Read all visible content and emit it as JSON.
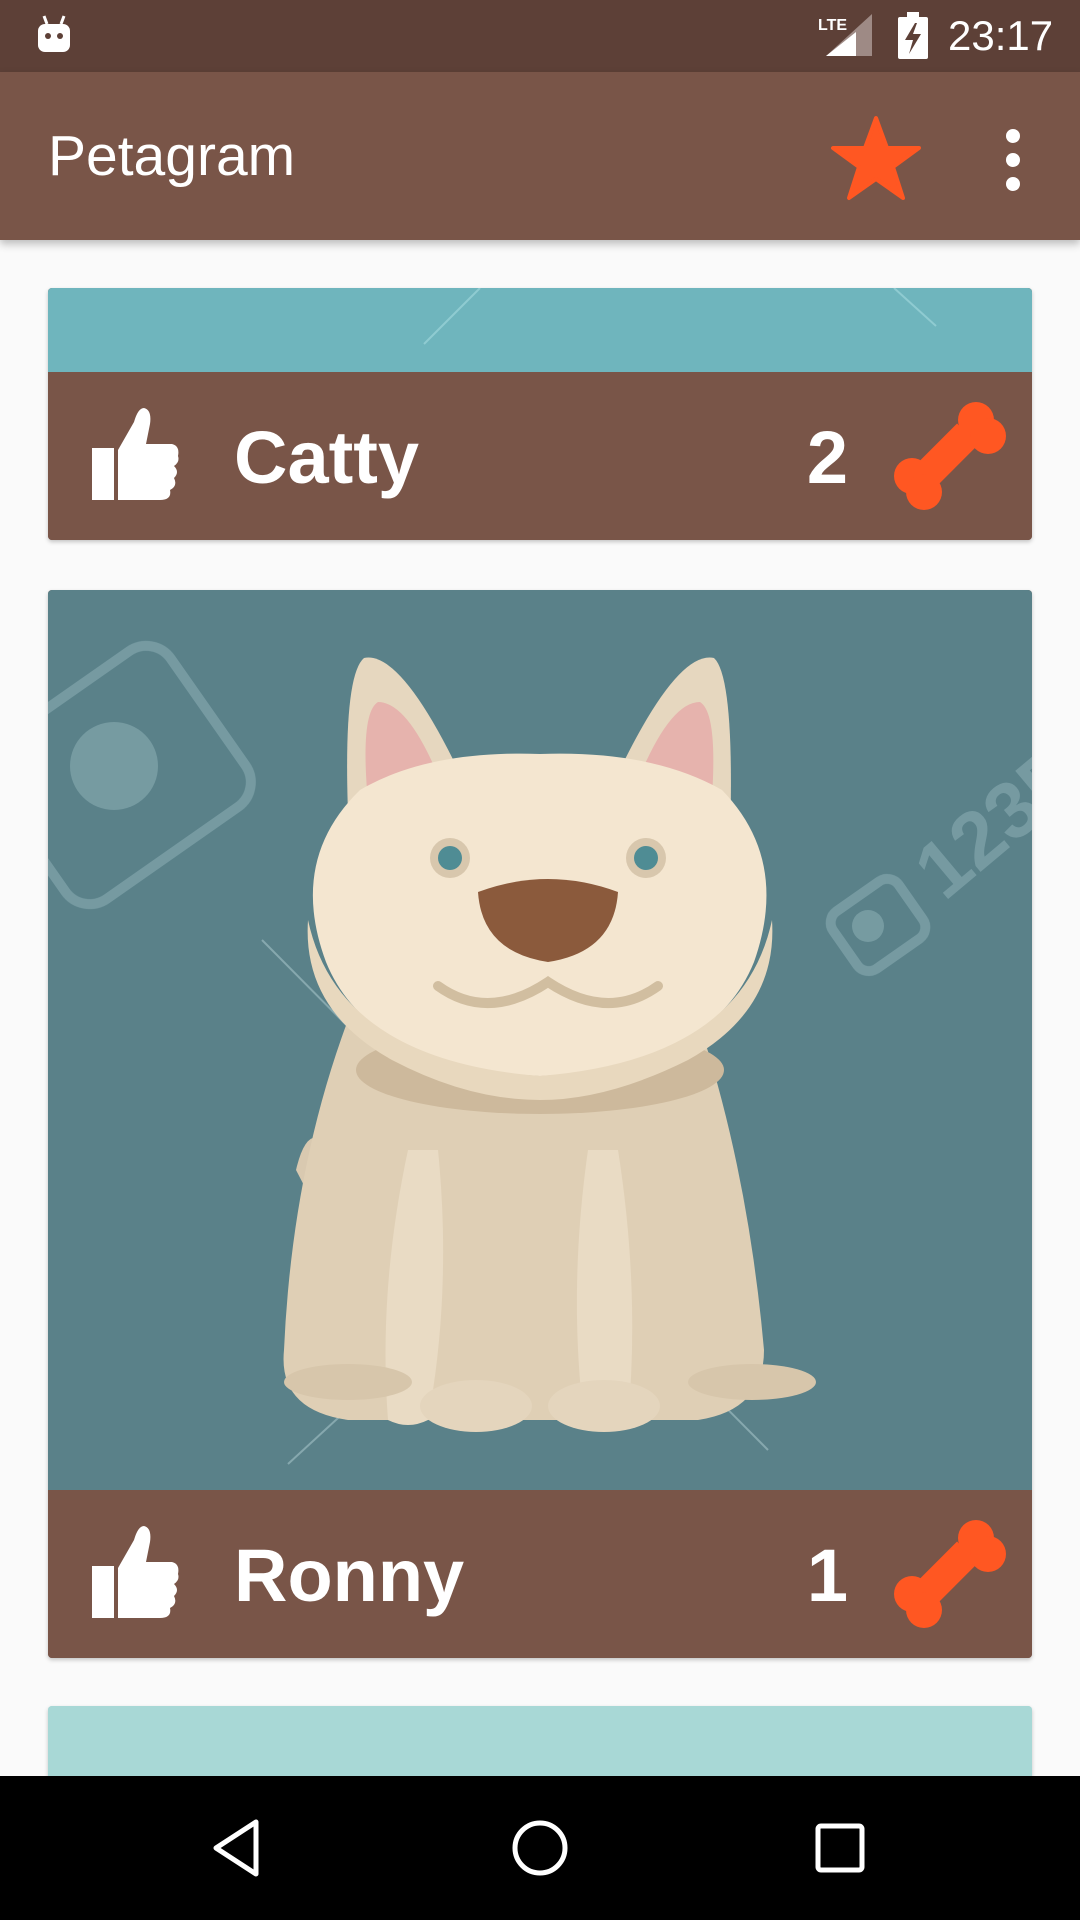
{
  "status_bar": {
    "time": "23:17",
    "network": "LTE",
    "icons": [
      "android-icon",
      "lte-signal-icon",
      "battery-charging-icon"
    ]
  },
  "app_bar": {
    "title": "Petagram",
    "actions": [
      "star-icon",
      "overflow-menu-icon"
    ]
  },
  "pets": [
    {
      "name": "Catty",
      "likes": "2"
    },
    {
      "name": "Ronny",
      "likes": "1"
    }
  ],
  "colors": {
    "status_bar": "#5d4037",
    "primary": "#795548",
    "accent": "#ff5722",
    "background": "#fafafa"
  },
  "nav_bar": {
    "buttons": [
      "back-icon",
      "home-icon",
      "recents-icon"
    ]
  }
}
